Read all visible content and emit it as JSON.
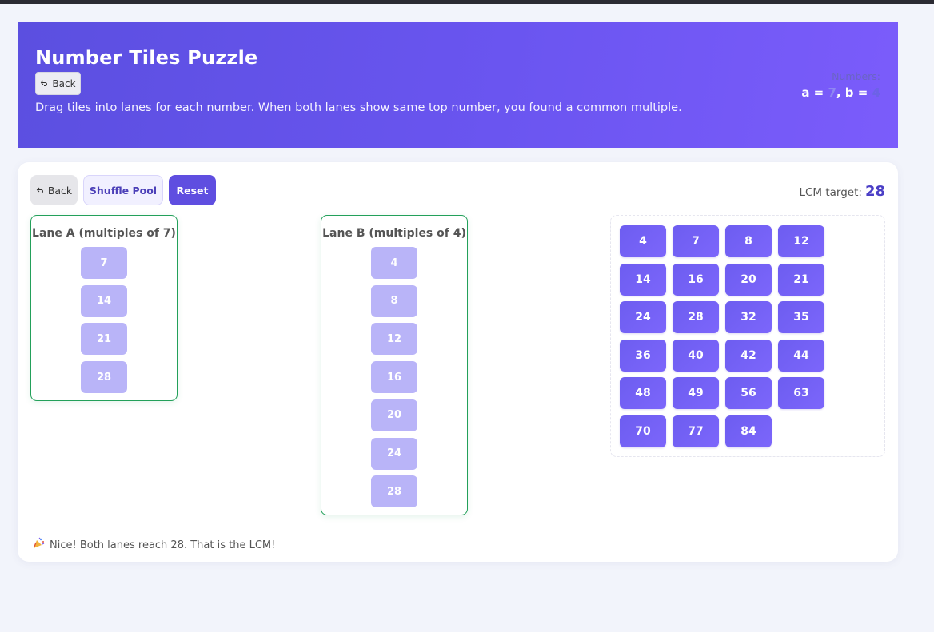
{
  "header": {
    "title": "Number Tiles Puzzle",
    "back_label": "Back",
    "subtitle": "Drag tiles into lanes for each number. When both lanes show same top number, you found a common multiple.",
    "numbers_label": "Numbers:",
    "a_prefix": "a = ",
    "a_value": "7",
    "b_prefix": ", b = ",
    "b_value": "4"
  },
  "toolbar": {
    "back_label": "Back",
    "shuffle_label": "Shuffle Pool",
    "reset_label": "Reset",
    "lcm_label": "LCM target:",
    "lcm_value": "28"
  },
  "lanes": {
    "a": {
      "title": "Lane A (multiples of 7)",
      "tiles": [
        "7",
        "14",
        "21",
        "28"
      ]
    },
    "b": {
      "title": "Lane B (multiples of 4)",
      "tiles": [
        "4",
        "8",
        "12",
        "16",
        "20",
        "24",
        "28"
      ]
    }
  },
  "pool": {
    "tiles": [
      "4",
      "7",
      "8",
      "12",
      "14",
      "16",
      "20",
      "21",
      "24",
      "28",
      "32",
      "35",
      "36",
      "40",
      "42",
      "44",
      "48",
      "49",
      "56",
      "63",
      "70",
      "77",
      "84"
    ]
  },
  "status": {
    "icon": "party-popper-icon",
    "text": "Nice! Both lanes reach 28. That is the LCM!"
  },
  "colors": {
    "accent": "#5f4ee0",
    "lane_border": "#23a05a",
    "lane_tile": "#b9b4f8"
  }
}
